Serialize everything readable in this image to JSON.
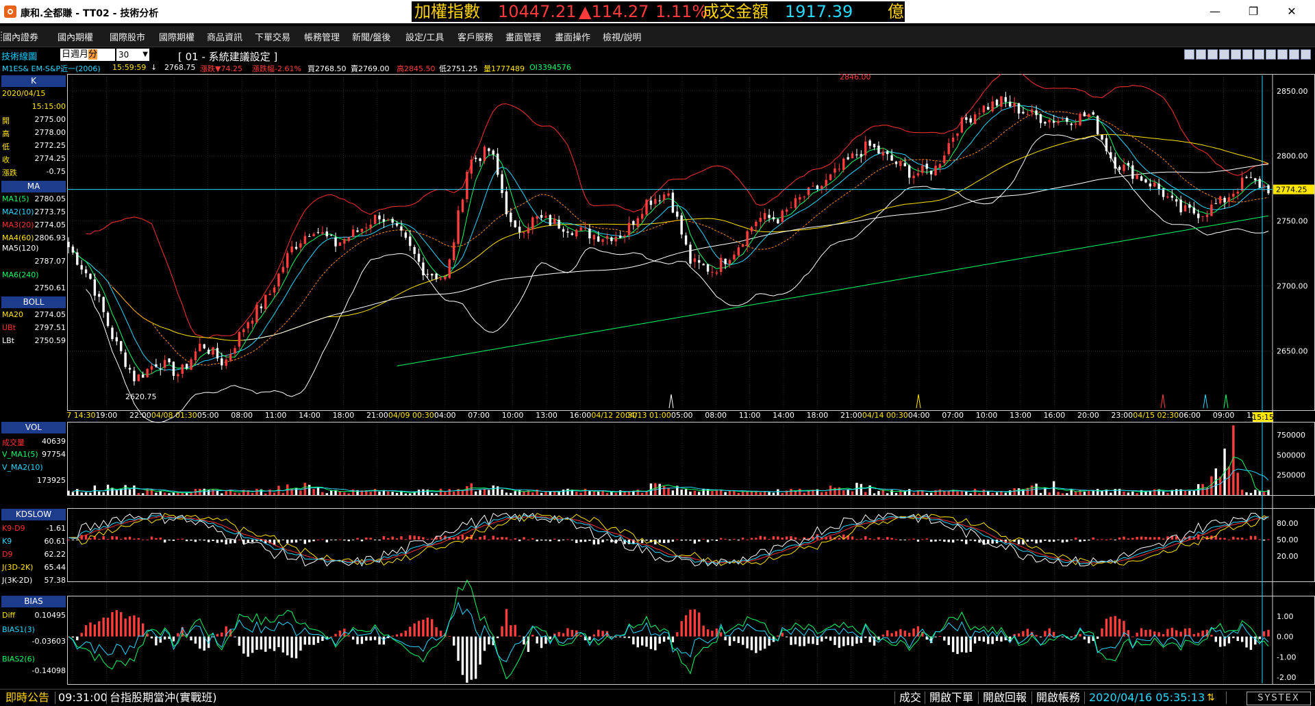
{
  "window": {
    "title": "康和.全都賺 - TT02 - 技術分析",
    "controls": {
      "minimize": "—",
      "maximize": "❐",
      "close": "✕"
    }
  },
  "index_banner": {
    "label": "加權指數",
    "value": "10447.21",
    "change": "▲114.27",
    "change_pct": "1.11%",
    "turnover_label": "成交金額",
    "turnover": "1917.39",
    "unit": "億",
    "colors": {
      "label": "#ffd400",
      "value": "#ff3a3a",
      "turnover": "#27d9ff"
    }
  },
  "menu": [
    "國內證券",
    "國內期權",
    "國際股市",
    "國際期權",
    "商品資訊",
    "下單交易",
    "帳務管理",
    "新聞/盤後",
    "設定/工具",
    "客戶服務",
    "畫面管理",
    "畫面操作",
    "檢視/說明"
  ],
  "toolbar": {
    "title": "技術線圖",
    "period_options": [
      "日",
      "週",
      "月",
      "分"
    ],
    "selected_period": "分",
    "interval": "30",
    "settings_label": "[ 01 - 系統建議設定 ]",
    "icons": [
      "crosshair-icon",
      "minus-icon",
      "plus-icon",
      "zoom-in-icon",
      "zoom-out-icon",
      "search-icon",
      "print-icon",
      "copy-icon",
      "save-icon",
      "window-icon",
      "close-icon"
    ]
  },
  "quote": {
    "symbol": "M1ES& EM-S&P近一(2006)",
    "time": "15:59:59",
    "arrow": "↓",
    "last": "2768.75",
    "change": "漲跌▼74.25",
    "change_pct": "漲跌幅-2.61%",
    "bid": "買2768.50",
    "ask": "賣2769.00",
    "high": "高2845.50",
    "low": "低2751.25",
    "volume": "量1777489",
    "oi": "OI3394576"
  },
  "left_panel": {
    "k": {
      "header": "K",
      "date": "2020/04/15",
      "time": "15:15:00",
      "rows": [
        {
          "label": "開",
          "value": "2775.00"
        },
        {
          "label": "高",
          "value": "2778.00"
        },
        {
          "label": "低",
          "value": "2772.25"
        },
        {
          "label": "收",
          "value": "2774.25"
        },
        {
          "label": "漲跌",
          "value": "-0.75"
        }
      ]
    },
    "ma": {
      "header": "MA",
      "rows": [
        {
          "label": "MA1(5)",
          "value": "2780.05",
          "color": "#00ff66"
        },
        {
          "label": "MA2(10)",
          "value": "2773.75",
          "color": "#27d9ff"
        },
        {
          "label": "MA3(20)",
          "value": "2774.05",
          "color": "#ff3030"
        },
        {
          "label": "MA4(60)",
          "value": "2806.93",
          "color": "#ffe600"
        },
        {
          "label": "MA5(120)",
          "value": "2787.07",
          "color": "#ffffff"
        },
        {
          "label": "MA6(240)",
          "value": "2750.61",
          "color": "#00ff66"
        }
      ]
    },
    "boll": {
      "header": "BOLL",
      "rows": [
        {
          "label": "MA20",
          "value": "2774.05",
          "color": "#ffe600"
        },
        {
          "label": "UBt",
          "value": "2797.51",
          "color": "#ff3030"
        },
        {
          "label": "LBt",
          "value": "2750.59",
          "color": "#ffffff"
        }
      ]
    },
    "vol": {
      "header": "VOL",
      "rows": [
        {
          "label": "成交量",
          "value": "40639",
          "color": "#ff3030"
        },
        {
          "label": "V_MA1(5)",
          "value": "97754",
          "color": "#00ff66"
        },
        {
          "label": "V_MA2(10)",
          "value": "173925",
          "color": "#27d9ff"
        }
      ]
    },
    "kd": {
      "header": "KDSLOW",
      "rows": [
        {
          "label": "K9-D9",
          "value": "-1.61",
          "color": "#ff3030"
        },
        {
          "label": "K9",
          "value": "60.61",
          "color": "#27d9ff"
        },
        {
          "label": "D9",
          "value": "62.22",
          "color": "#ff3030"
        },
        {
          "label": "J(3D-2K)",
          "value": "65.44",
          "color": "#ffe600"
        },
        {
          "label": "J(3K-2D)",
          "value": "57.38",
          "color": "#ffffff"
        }
      ]
    },
    "bias": {
      "header": "BIAS",
      "rows": [
        {
          "label": "Diff",
          "value": "0.10495",
          "color": "#ffe600"
        },
        {
          "label": "BIAS1(3)",
          "value": "-0.03603",
          "color": "#27d9ff"
        },
        {
          "label": "BIAS2(6)",
          "value": "-0.14098",
          "color": "#00ff66"
        }
      ]
    }
  },
  "chart_data": {
    "type": "candlestick",
    "price_ticks": [
      "2850.00",
      "2800.00",
      "2750.00",
      "2700.00",
      "2650.00"
    ],
    "price_range": [
      2605,
      2862
    ],
    "last_price_tag": "2774.25",
    "high_annotation": "2846.00",
    "low_annotation": "2620.75",
    "x_labels": [
      "04/07 14:30",
      "19:00",
      "22:00",
      "04/08 01:30",
      "05:00",
      "08:00",
      "11:00",
      "14:00",
      "18:00",
      "21:00",
      "04/09 00:30",
      "04:00",
      "07:00",
      "10:00",
      "13:00",
      "16:00",
      "04/12 20:30",
      "04/13 01:00",
      "05:00",
      "08:00",
      "11:00",
      "14:00",
      "18:00",
      "21:00",
      "04/14 00:30",
      "04:00",
      "07:00",
      "10:00",
      "13:00",
      "16:00",
      "20:00",
      "23:00",
      "04/15 02:30",
      "06:00",
      "09:00",
      "12:00"
    ],
    "current_time_tag": "15:15",
    "close_anchors": [
      2730,
      2705,
      2660,
      2628,
      2642,
      2632,
      2656,
      2640,
      2672,
      2692,
      2728,
      2745,
      2732,
      2742,
      2755,
      2738,
      2712,
      2705,
      2795,
      2805,
      2740,
      2752,
      2748,
      2742,
      2738,
      2740,
      2765,
      2772,
      2718,
      2712,
      2728,
      2752,
      2752,
      2768,
      2778,
      2795,
      2808,
      2797,
      2786,
      2790,
      2822,
      2836,
      2842,
      2834,
      2828,
      2828,
      2832,
      2796,
      2786,
      2776,
      2758,
      2756,
      2766,
      2782,
      2775
    ],
    "volume_ticks": [
      "750000",
      "500000",
      "250000"
    ],
    "volume_range": [
      0,
      880000
    ],
    "kd_ticks": [
      "80.00",
      "50.00",
      "20.00"
    ],
    "kd_range": [
      0,
      100
    ],
    "bias_ticks": [
      "1.00",
      "0.00",
      "-1.00",
      "-2.00"
    ],
    "bias_range": [
      -2.3,
      1.8
    ],
    "colors": {
      "up": "#ff3d3d",
      "down": "#ffffff",
      "ma5": "#00ff66",
      "ma10": "#27d9ff",
      "ma20": "#ff3030",
      "ma60": "#ffe600",
      "ma120": "#ffffff",
      "ma240": "#00ff66",
      "boll_up": "#ff3030",
      "boll_low": "#ffffff",
      "grid": "#2a2a2a",
      "cursor": "#27d9ff",
      "tag": "#ffe600"
    }
  },
  "status": {
    "notice_label": "即時公告",
    "notice_time": "09:31:00",
    "notice_text": "台指股期當沖(實戰班)",
    "buttons": [
      "成交",
      "開啟下單",
      "開啟回報",
      "開啟帳務"
    ],
    "datetime": "2020/04/16 05:35:13",
    "brand": "SYSTEX"
  }
}
